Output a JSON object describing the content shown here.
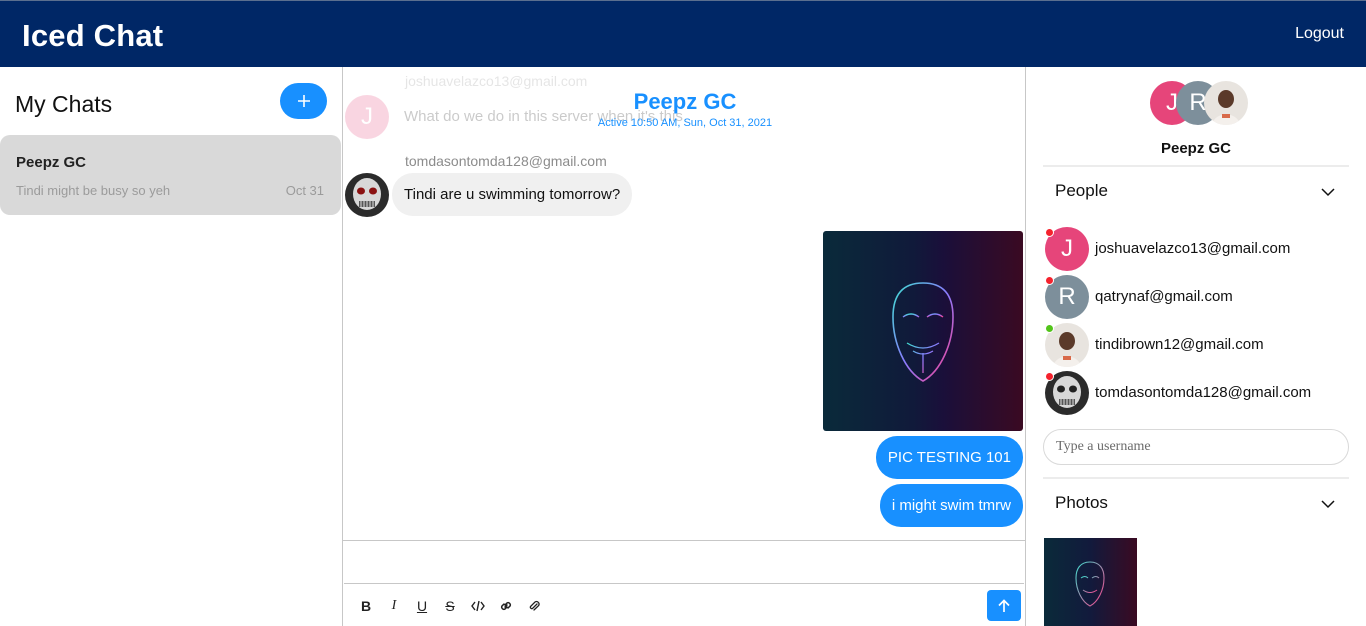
{
  "app": {
    "title": "Iced Chat",
    "logout_label": "Logout"
  },
  "sidebar": {
    "title": "My Chats",
    "new_chat_icon": "plus-icon",
    "chats": [
      {
        "title": "Peepz GC",
        "last_message": "Tindi might be busy so yeh",
        "date": "Oct 31"
      }
    ]
  },
  "chat": {
    "title": "Peepz GC",
    "subtitle": "Active 10:50 AM, Sun, Oct 31, 2021",
    "messages": [
      {
        "sender": "joshuavelazco13@gmail.com",
        "avatar_letter": "J",
        "text": "What do we do in this server when it's this"
      },
      {
        "sender": "tomdasontomda128@gmail.com",
        "text": "Tindi are u swimming tomorrow?"
      },
      {
        "type": "image",
        "outgoing": true
      },
      {
        "text": "PIC TESTING 101",
        "outgoing": true
      },
      {
        "text": "i might swim tmrw",
        "outgoing": true
      }
    ],
    "composer": {
      "tools": [
        "bold-icon",
        "italic-icon",
        "underline-icon",
        "strikethrough-icon",
        "code-icon",
        "link-icon",
        "attachment-icon"
      ],
      "send_icon": "arrow-up-icon"
    }
  },
  "details": {
    "group_name": "Peepz GC",
    "people_title": "People",
    "people": [
      {
        "email": "joshuavelazco13@gmail.com",
        "avatar_letter": "J",
        "avatar_color": "#e6457a",
        "status": "offline"
      },
      {
        "email": "qatrynaf@gmail.com",
        "avatar_letter": "R",
        "avatar_color": "#7d8f9b",
        "status": "offline"
      },
      {
        "email": "tindibrown12@gmail.com",
        "avatar_letter": "",
        "status": "online"
      },
      {
        "email": "tomdasontomda128@gmail.com",
        "avatar_letter": "",
        "status": "offline"
      }
    ],
    "search_placeholder": "Type a username",
    "photos_title": "Photos"
  },
  "colors": {
    "topbar": "#002766",
    "accent": "#1890ff",
    "online": "#52c41a",
    "offline": "#f5222d"
  }
}
